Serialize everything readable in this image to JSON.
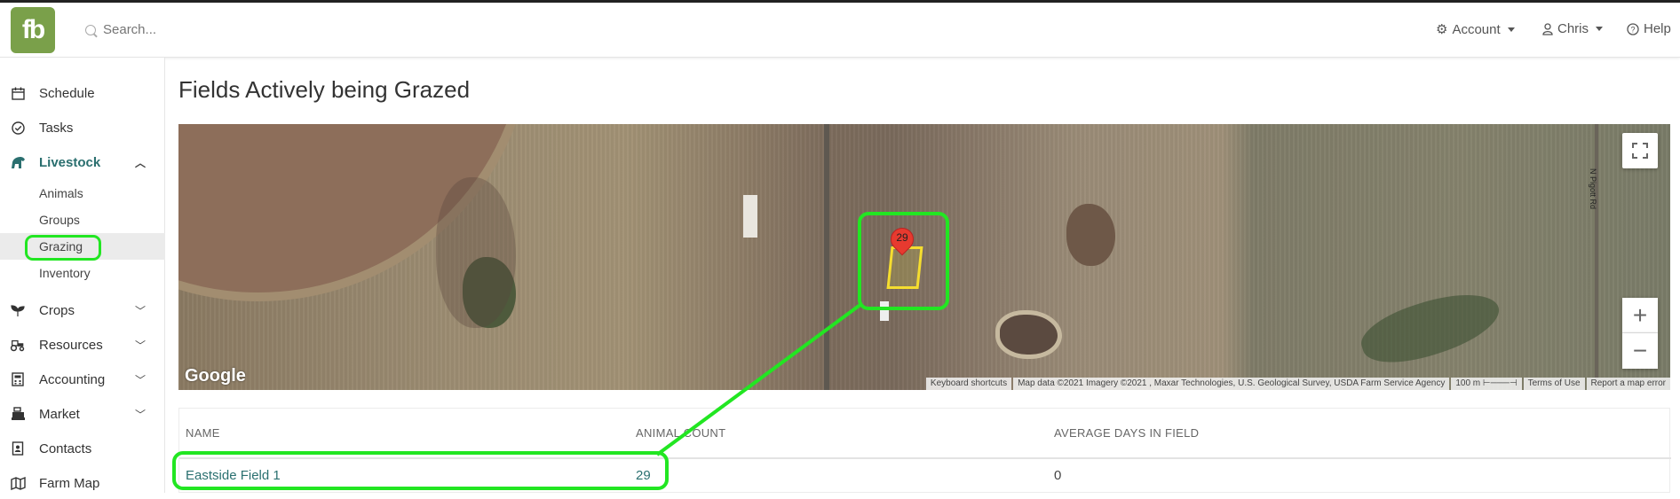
{
  "app": {
    "logo_text": "fb",
    "brand_color": "#7aa04a",
    "accent_color": "#2a6f6f",
    "highlight_color": "#22e622"
  },
  "search": {
    "placeholder": "Search..."
  },
  "topnav": {
    "account_label": "Account",
    "user_label": "Chris",
    "help_label": "Help"
  },
  "sidebar": {
    "items": [
      {
        "label": "Schedule",
        "icon": "calendar-icon"
      },
      {
        "label": "Tasks",
        "icon": "check-circle-icon"
      },
      {
        "label": "Livestock",
        "icon": "livestock-icon",
        "expanded": true
      },
      {
        "label": "Crops",
        "icon": "sprout-icon"
      },
      {
        "label": "Resources",
        "icon": "tractor-icon"
      },
      {
        "label": "Accounting",
        "icon": "calculator-icon"
      },
      {
        "label": "Market",
        "icon": "cash-register-icon"
      },
      {
        "label": "Contacts",
        "icon": "address-book-icon"
      },
      {
        "label": "Farm Map",
        "icon": "map-icon"
      }
    ],
    "livestock_subitems": [
      {
        "label": "Animals"
      },
      {
        "label": "Groups"
      },
      {
        "label": "Grazing",
        "selected": true
      },
      {
        "label": "Inventory"
      }
    ]
  },
  "main": {
    "title": "Fields Actively being Grazed"
  },
  "map": {
    "marker_count": "29",
    "road_label": "N Pigott Rd",
    "google_label": "Google",
    "attribution": {
      "shortcuts": "Keyboard shortcuts",
      "data": "Map data ©2021 Imagery ©2021 , Maxar Technologies, U.S. Geological Survey, USDA Farm Service Agency",
      "scale": "100 m",
      "terms": "Terms of Use",
      "report": "Report a map error"
    },
    "zoom_in_label": "+",
    "zoom_out_label": "−"
  },
  "table": {
    "headers": [
      "NAME",
      "ANIMAL COUNT",
      "AVERAGE DAYS IN FIELD"
    ],
    "rows": [
      {
        "name": "Eastside Field 1",
        "animal_count": "29",
        "avg_days": "0"
      }
    ]
  }
}
